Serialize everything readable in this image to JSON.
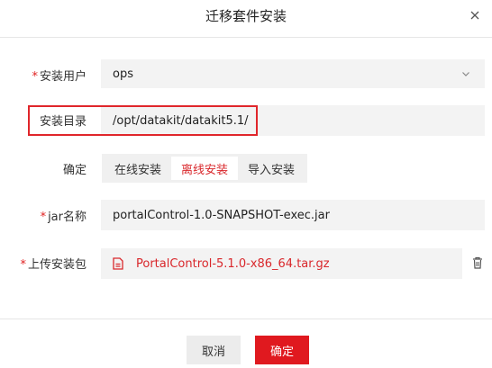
{
  "dialog": {
    "title": "迁移套件安装",
    "close_icon": "close-icon"
  },
  "form": {
    "required_mark": "*",
    "user": {
      "label": "安装用户",
      "value": "ops",
      "icon": "chevron-down-icon"
    },
    "directory": {
      "label": "安装目录",
      "value": "/opt/datakit/datakit5.1/",
      "highlight_color": "#e0262b"
    },
    "mode": {
      "label": "确定",
      "options": [
        "在线安装",
        "离线安装",
        "导入安装"
      ],
      "selected": "离线安装"
    },
    "jar": {
      "label": "jar名称",
      "value": "portalControl-1.0-SNAPSHOT-exec.jar"
    },
    "package": {
      "label": "上传安装包",
      "file_name": "PortalControl-5.1.0-x86_64.tar.gz",
      "file_icon": "file-icon",
      "delete_icon": "trash-icon"
    }
  },
  "footer": {
    "cancel_label": "取消",
    "ok_label": "确定"
  },
  "colors": {
    "accent": "#e0191f",
    "required": "#e02020",
    "field_bg": "#f3f3f3"
  }
}
